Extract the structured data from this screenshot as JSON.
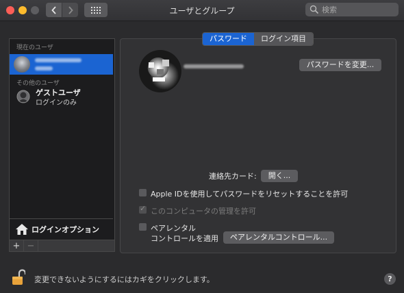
{
  "window": {
    "title": "ユーザとグループ"
  },
  "toolbar": {
    "search_placeholder": "検索"
  },
  "sidebar": {
    "current_user_label": "現在のユーザ",
    "other_users_label": "その他のユーザ",
    "guest": {
      "name": "ゲストユーザ",
      "subtitle": "ログインのみ"
    },
    "login_options_label": "ログインオプション",
    "add_label": "+",
    "remove_label": "−"
  },
  "tabs": {
    "password": "パスワード",
    "login_items": "ログイン項目"
  },
  "main": {
    "change_password_label": "パスワードを変更...",
    "contact_card_label": "連絡先カード:",
    "open_label": "開く...",
    "allow_reset": "Apple IDを使用してパスワードをリセットすることを許可",
    "allow_admin": "このコンピュータの管理を許可",
    "parental_line1": "ペアレンタル",
    "parental_line2": "コントロールを適用",
    "parental_button": "ペアレンタルコントロール..."
  },
  "footer": {
    "lock_text": "変更できないようにするにはカギをクリックします。",
    "help_label": "?"
  },
  "colors": {
    "accent": "#1b64d2",
    "background": "#2b2b2d"
  }
}
